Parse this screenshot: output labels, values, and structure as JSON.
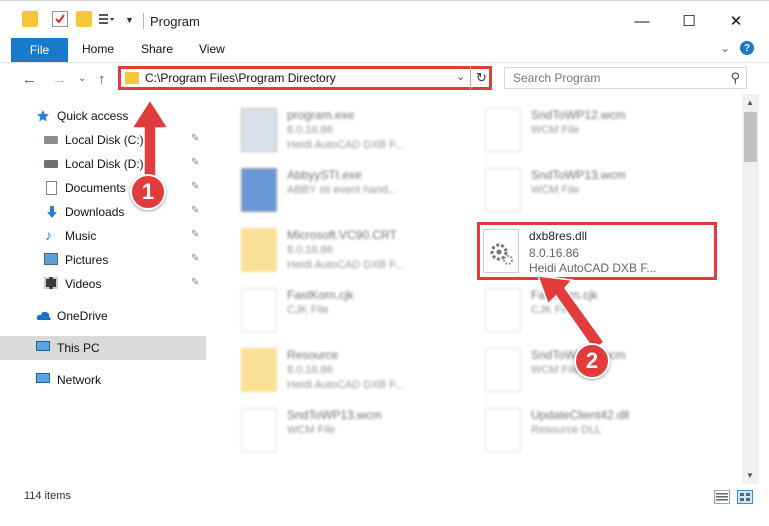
{
  "window": {
    "title": "Program",
    "minimize": "—",
    "maximize": "☐",
    "close": "✕"
  },
  "ribbon": {
    "tabs": [
      "File",
      "Home",
      "Share",
      "View"
    ],
    "expand": "⌄",
    "help": "?"
  },
  "nav": {
    "back": "←",
    "forward": "→",
    "recent": "⌄",
    "up": "↑",
    "address_path": "C:\\Program Files\\Program Directory",
    "address_chevron": "⌄",
    "refresh": "↻",
    "search_placeholder": "Search Program",
    "search_icon": "⚲"
  },
  "sidebar": {
    "items": [
      {
        "label": "Quick access",
        "icon": "star-icon",
        "pinned": false
      },
      {
        "label": "Local Disk (C:)",
        "icon": "drive-icon",
        "pinned": true
      },
      {
        "label": "Local Disk (D:)",
        "icon": "drive-icon",
        "pinned": true
      },
      {
        "label": "Documents",
        "icon": "documents-icon",
        "pinned": true
      },
      {
        "label": "Downloads",
        "icon": "download-icon",
        "pinned": true
      },
      {
        "label": "Music",
        "icon": "music-icon",
        "pinned": true
      },
      {
        "label": "Pictures",
        "icon": "pictures-icon",
        "pinned": true
      },
      {
        "label": "Videos",
        "icon": "videos-icon",
        "pinned": true
      },
      {
        "label": "OneDrive",
        "icon": "cloud-icon",
        "pinned": false
      },
      {
        "label": "This PC",
        "icon": "pc-icon",
        "pinned": false,
        "selected": true
      },
      {
        "label": "Network",
        "icon": "network-icon",
        "pinned": false
      }
    ],
    "pin_glyph": "📌"
  },
  "files": [
    {
      "name": "program.exe",
      "sub1": "8.0.16.86",
      "sub2": "Heidi AutoCAD DXB F...",
      "type": "exe"
    },
    {
      "name": "SndToWP12.wcm",
      "sub1": "WCM File",
      "sub2": "",
      "type": "doc"
    },
    {
      "name": "AbbyySTI.exe",
      "sub1": "ABBY sti event hand...",
      "sub2": "",
      "type": "exe2"
    },
    {
      "name": "SndToWP13.wcm",
      "sub1": "WCM File",
      "sub2": "",
      "type": "doc"
    },
    {
      "name": "Microsoft.VC90.CRT",
      "sub1": "8.0.16.86",
      "sub2": "Heidi AutoCAD DXB F...",
      "type": "folder"
    },
    {
      "name": "dxb8res.dll",
      "sub1": "8.0.16.86",
      "sub2": "Heidi AutoCAD DXB F...",
      "type": "dll",
      "highlighted": true
    },
    {
      "name": "FastKorn.cjk",
      "sub1": "CJK File",
      "sub2": "",
      "type": "doc"
    },
    {
      "name": "FastKorn.cjk",
      "sub1": "CJK File",
      "sub2": "",
      "type": "doc"
    },
    {
      "name": "Resource",
      "sub1": "8.0.16.86",
      "sub2": "Heidi AutoCAD DXB F...",
      "type": "folder"
    },
    {
      "name": "SndToWP13.wcm",
      "sub1": "WCM File",
      "sub2": "",
      "type": "doc"
    },
    {
      "name": "SndToWP13.wcm",
      "sub1": "WCM File",
      "sub2": "",
      "type": "doc"
    },
    {
      "name": "UpdateClient42.dll",
      "sub1": "Resource DLL",
      "sub2": "",
      "type": "dll"
    }
  ],
  "status": {
    "item_count": "114 items"
  },
  "annotations": {
    "step1": "1",
    "step2": "2",
    "color": "#e23b3b"
  }
}
